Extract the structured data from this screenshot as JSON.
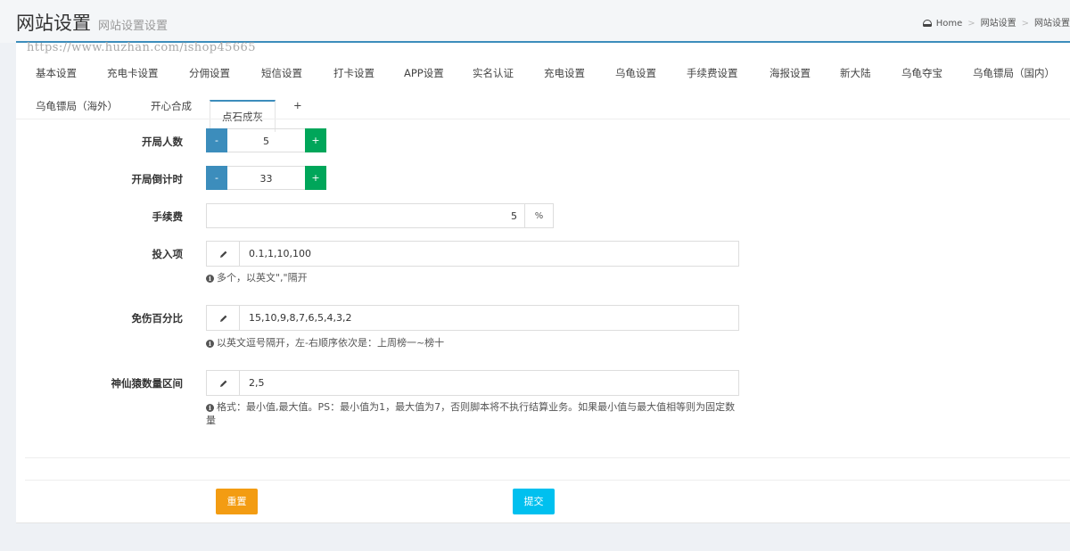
{
  "header": {
    "title": "网站设置",
    "subtitle": "网站设置设置",
    "breadcrumb": [
      "Home",
      "网站设置",
      "网站设置"
    ]
  },
  "watermark": "https://www.huzhan.com/ishop45665",
  "tabs": [
    "基本设置",
    "充电卡设置",
    "分佣设置",
    "短信设置",
    "打卡设置",
    "APP设置",
    "实名认证",
    "充电设置",
    "乌龟设置",
    "手续费设置",
    "海报设置",
    "新大陆",
    "乌龟夺宝",
    "乌龟镖局（国内）",
    "乌龟镖局（海外）",
    "开心合成",
    "点石成灰",
    "+"
  ],
  "active_tab": "点石成灰",
  "form": {
    "players": {
      "label": "开局人数",
      "value": "5",
      "minus": "-",
      "plus": "+"
    },
    "countdown": {
      "label": "开局倒计时",
      "value": "33",
      "minus": "-",
      "plus": "+"
    },
    "fee": {
      "label": "手续费",
      "value": "5",
      "unit": "%"
    },
    "bets": {
      "label": "投入项",
      "value": "0.1,1,10,100",
      "help": "多个，以英文\",\"隔开"
    },
    "immunity": {
      "label": "免伤百分比",
      "value": "15,10,9,8,7,6,5,4,3,2",
      "help": "以英文逗号隔开，左-右顺序依次是：上周榜一~榜十"
    },
    "monkey": {
      "label": "神仙猿数量区间",
      "value": "2,5",
      "help": "格式：最小值,最大值。PS：最小值为1，最大值为7，否则脚本将不执行结算业务。如果最小值与最大值相等则为固定数量"
    }
  },
  "buttons": {
    "reset": "重置",
    "submit": "提交"
  },
  "colors": {
    "primary": "#3c8dbc",
    "success": "#00a65a",
    "warning": "#f39c12",
    "info": "#00c0ef"
  }
}
